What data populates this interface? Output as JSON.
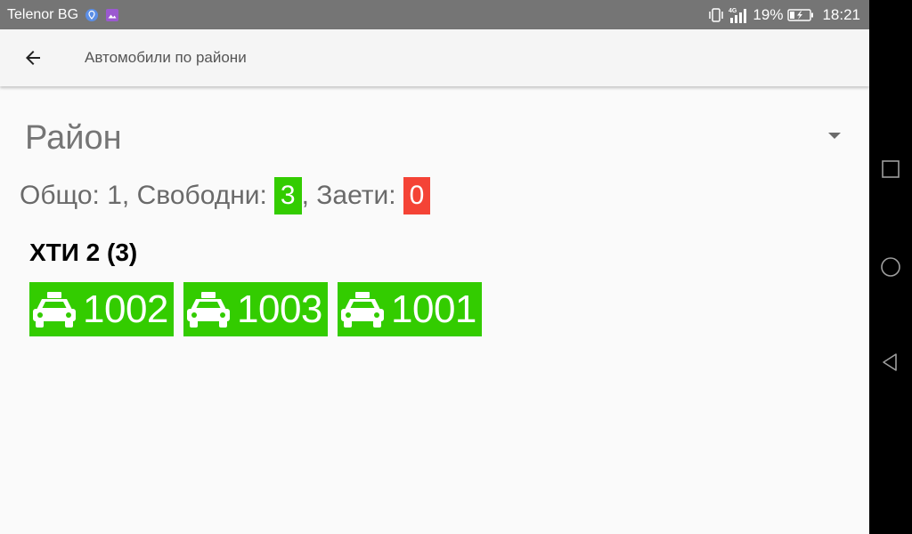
{
  "status_bar": {
    "carrier": "Telenor BG",
    "network": "4G",
    "battery": "19%",
    "time": "18:21"
  },
  "app_bar": {
    "title": "Автомобили по райони"
  },
  "district_select": {
    "label": "Район"
  },
  "summary": {
    "total_text": "Общо: 1, Свободни:",
    "free_count": "3",
    "busy_text": ", Заети:",
    "busy_count": "0"
  },
  "group": {
    "title": "ХТИ 2 (3)",
    "cars": [
      {
        "number": "1002"
      },
      {
        "number": "1003"
      },
      {
        "number": "1001"
      }
    ]
  },
  "colors": {
    "free": "#33cc00",
    "busy": "#f44336",
    "status_bar": "#757575"
  },
  "icons": [
    "back-arrow-icon",
    "taxi-icon",
    "dropdown-arrow-icon",
    "vibrate-icon",
    "signal-icon",
    "battery-charging-icon",
    "recent-apps-icon",
    "home-icon",
    "back-nav-icon"
  ]
}
